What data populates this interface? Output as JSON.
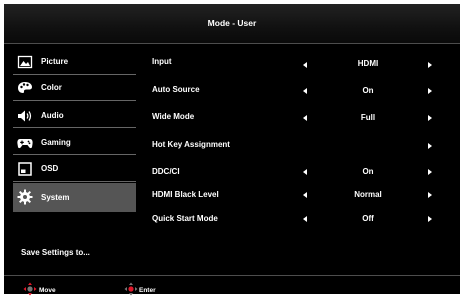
{
  "header": {
    "title": "Mode - User"
  },
  "sidebar": {
    "items": [
      {
        "label": "Picture",
        "icon": "picture-icon",
        "selected": false
      },
      {
        "label": "Color",
        "icon": "palette-icon",
        "selected": false
      },
      {
        "label": "Audio",
        "icon": "speaker-icon",
        "selected": false
      },
      {
        "label": "Gaming",
        "icon": "gamepad-icon",
        "selected": false
      },
      {
        "label": "OSD",
        "icon": "osd-window-icon",
        "selected": false
      },
      {
        "label": "System",
        "icon": "gear-icon",
        "selected": true
      }
    ],
    "save_label": "Save Settings to..."
  },
  "settings": [
    {
      "label": "Input",
      "value": "HDMI",
      "has_left": true,
      "has_right": true
    },
    {
      "label": "Auto Source",
      "value": "On",
      "has_left": true,
      "has_right": true
    },
    {
      "label": "Wide Mode",
      "value": "Full",
      "has_left": true,
      "has_right": true
    },
    {
      "label": "Hot Key Assignment",
      "value": "",
      "has_left": false,
      "has_right": true
    },
    {
      "label": "DDC/CI",
      "value": "On",
      "has_left": true,
      "has_right": true
    },
    {
      "label": "HDMI Black Level",
      "value": "Normal",
      "has_left": true,
      "has_right": true
    },
    {
      "label": "Quick Start Mode",
      "value": "Off",
      "has_left": true,
      "has_right": true
    }
  ],
  "footer": {
    "move_label": "Move",
    "enter_label": "Enter",
    "move_icon": "dpad-move-icon",
    "enter_icon": "dpad-enter-icon"
  },
  "colors": {
    "background": "#000000",
    "selected": "#555555",
    "accent": "#e0182a"
  }
}
